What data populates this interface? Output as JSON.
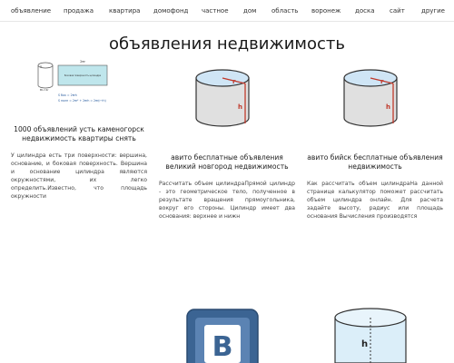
{
  "nav": {
    "items": [
      "объявление",
      "продажа",
      "квартира",
      "домофонд",
      "частное",
      "дом",
      "область",
      "воронеж",
      "доска",
      "сайт",
      "другие"
    ]
  },
  "page": {
    "title": "объявления недвижимость"
  },
  "diagram_labels": {
    "rect_top": "2πr",
    "rect_inner": "Боковая поверхность цилиндра",
    "dim_a": "A",
    "dim_b": "B",
    "dim_bottom": "L=2r",
    "formula1": "S бок = 2πrh",
    "formula2": "S полн = 2πr² + 2πrh = 2πr(r+h)",
    "r": "r",
    "h": "h"
  },
  "cards": [
    {
      "title": "1000 объявлений усть каменогорск недвижимость квартиры снять",
      "text": "У цилиндра есть три поверхности: вершина, основание, и боковая поверхность. Вершина и основание цилиндра являются окружностями, их легко определить.Известно, что площадь окружности"
    },
    {
      "title": "авито бесплатные объявления великий новгород недвижимость",
      "text": "Рассчитать объем цилиндраПрямой цилиндр - это геометрическое тело, полученное в результате вращения прямоугольника, вокруг его стороны. Цилиндр имеет два основания: верхнее и нижн"
    },
    {
      "title": "авито бийск бесплатные объявления недвижимость",
      "text": "Как рассчитать объем цилиндраНа данной странице калькулятор поможет рассчитать объем цилиндра онлайн. Для расчета задайте высоту, радиус или площадь основания Вычисления производятся"
    }
  ],
  "vk_logo_letter": "B",
  "colors": {
    "cylinder_top": "#cfe5f5",
    "cylinder_body": "#e0e0e0",
    "radius_line": "#c0392b",
    "height_line": "#c0392b",
    "vk_blue": "#3b6493"
  }
}
